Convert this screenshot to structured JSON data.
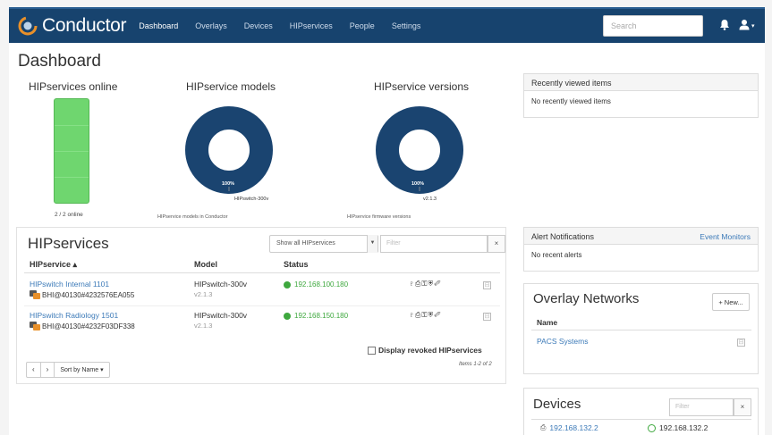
{
  "nav": {
    "brand": "Conductor",
    "links": [
      "Dashboard",
      "Overlays",
      "Devices",
      "HIPservices",
      "People",
      "Settings"
    ],
    "search_placeholder": "Search"
  },
  "page_title": "Dashboard",
  "widgets": {
    "online": {
      "title": "HIPservices online",
      "caption": "2 / 2 online",
      "online": 2,
      "total": 2
    },
    "models": {
      "title": "HIPservice models",
      "pct": "100%",
      "slice_label": "HIPswitch-300v",
      "caption": "HIPservice models in Conductor"
    },
    "versions": {
      "title": "HIPservice versions",
      "pct": "100%",
      "slice_label": "v2.1.3",
      "caption": "HIPservice firmware versions"
    }
  },
  "colors": {
    "navbar": "#17436e",
    "donut": "#1a4470",
    "online_bar": "#6fd66f",
    "link": "#3c7ab8",
    "status_ok": "#3ea83e"
  },
  "hipservices": {
    "title": "HIPservices",
    "filter_select": "Show all HIPservices",
    "filter_placeholder": "Filter",
    "clear": "×",
    "columns": {
      "name": "HIPservice ▴",
      "model": "Model",
      "status": "Status"
    },
    "rows": [
      {
        "name": "HIPswitch Internal 1101",
        "id": "BHI@40130#4232576EA055",
        "model": "HIPswitch-300v",
        "version": "v2.1.3",
        "ip": "192.168.100.180",
        "icons": "♇⎙⚿⛨✐"
      },
      {
        "name": "HIPswitch Radiology 1501",
        "id": "BHI@40130#4232F03DF338",
        "model": "HIPswitch-300v",
        "version": "v2.1.3",
        "ip": "192.168.150.180",
        "icons": "♇⎙⚿⛨✐"
      }
    ],
    "revoked_label": "Display revoked HIPservices",
    "items_count": "Items 1-2 of 2",
    "pager": {
      "prev": "‹",
      "next": "›",
      "sort": "Sort by Name ▾"
    },
    "expand": "⊟"
  },
  "recent": {
    "title": "Recently viewed items",
    "body": "No recently viewed items"
  },
  "alerts": {
    "title": "Alert Notifications",
    "link": "Event Monitors",
    "body": "No recent alerts"
  },
  "overlays": {
    "title": "Overlay Networks",
    "new_btn": "+ New...",
    "col": "Name",
    "items": [
      "PACS Systems"
    ],
    "expand": "⊟"
  },
  "devices": {
    "title": "Devices",
    "filter_placeholder": "Filter",
    "clear": "×",
    "first_ip": "192.168.132.2",
    "first_status": "192.168.132.2"
  }
}
